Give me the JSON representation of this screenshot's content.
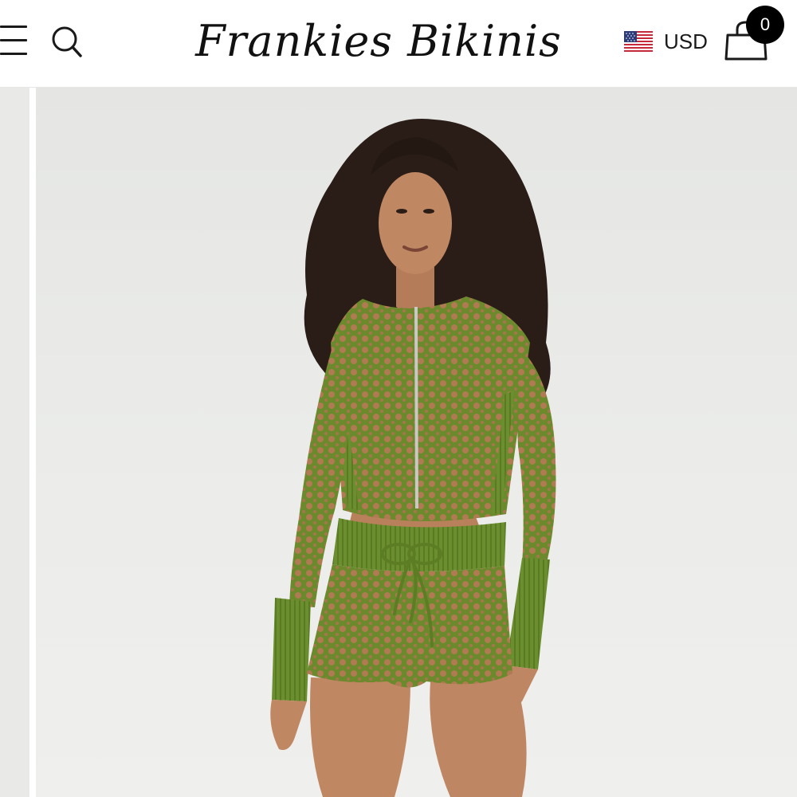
{
  "header": {
    "brand": "Frankies Bikinis",
    "currency": "USD",
    "cart_count": "0"
  },
  "icons": {
    "menu": "hamburger-menu-icon",
    "search": "search-icon",
    "flag": "us-flag-icon",
    "cart": "shopping-bag-icon"
  },
  "colors": {
    "garment_green": "#6f8f2f",
    "background": "#e8e9e7"
  }
}
